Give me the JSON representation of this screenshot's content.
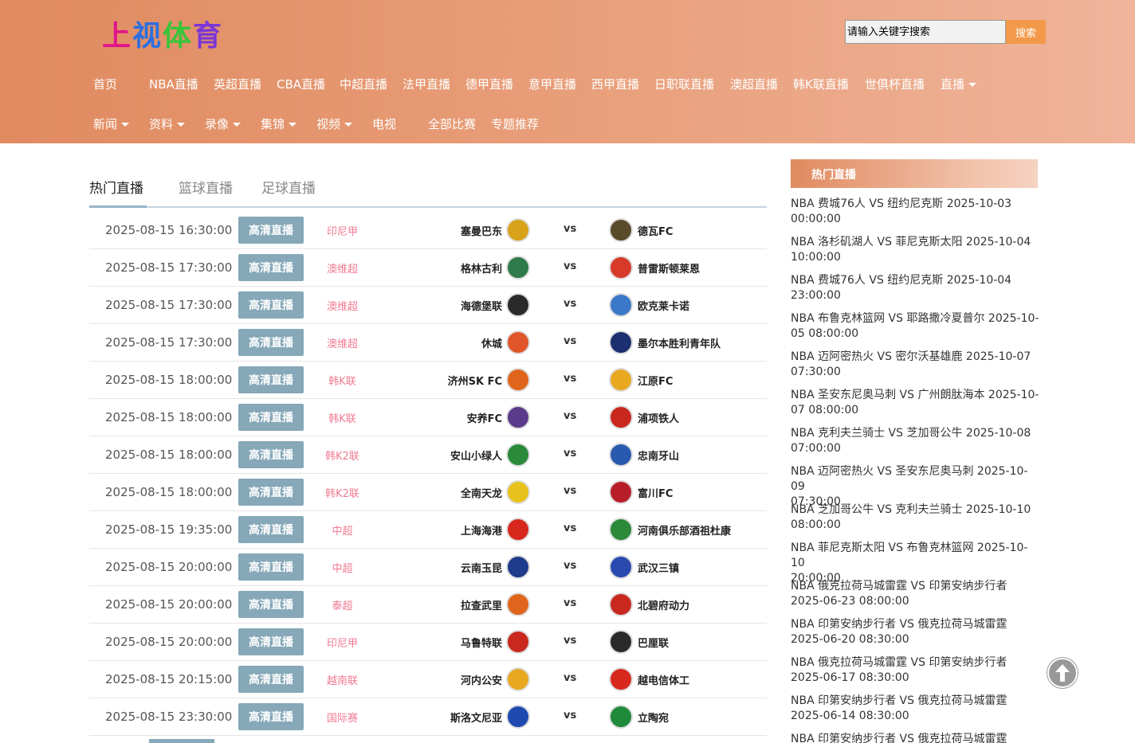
{
  "header": {
    "logo_chars": [
      "上",
      "视",
      "体",
      "育"
    ],
    "search_placeholder": "请输入关键字搜索",
    "search_button": "搜索"
  },
  "nav_primary": [
    {
      "label": "首页",
      "dropdown": false
    },
    {
      "label": "NBA直播",
      "dropdown": false
    },
    {
      "label": "英超直播",
      "dropdown": false
    },
    {
      "label": "CBA直播",
      "dropdown": false
    },
    {
      "label": "中超直播",
      "dropdown": false
    },
    {
      "label": "法甲直播",
      "dropdown": false
    },
    {
      "label": "德甲直播",
      "dropdown": false
    },
    {
      "label": "意甲直播",
      "dropdown": false
    },
    {
      "label": "西甲直播",
      "dropdown": false
    },
    {
      "label": "日职联直播",
      "dropdown": false
    },
    {
      "label": "澳超直播",
      "dropdown": false
    },
    {
      "label": "韩K联直播",
      "dropdown": false
    },
    {
      "label": "世俱杯直播",
      "dropdown": false
    },
    {
      "label": "直播",
      "dropdown": true
    }
  ],
  "nav_secondary": [
    {
      "label": "新闻",
      "dropdown": true
    },
    {
      "label": "资料",
      "dropdown": true
    },
    {
      "label": "录像",
      "dropdown": true
    },
    {
      "label": "集锦",
      "dropdown": true
    },
    {
      "label": "视频",
      "dropdown": true
    },
    {
      "label": "电视",
      "dropdown": false
    },
    {
      "label": "全部比赛",
      "dropdown": false
    },
    {
      "label": "专题推荐",
      "dropdown": false
    }
  ],
  "tabs": [
    {
      "label": "热门直播",
      "active": true
    },
    {
      "label": "篮球直播",
      "active": false
    },
    {
      "label": "足球直播",
      "active": false
    }
  ],
  "live_label": "高清直播",
  "vs_label": "vs",
  "matches": [
    {
      "time": "2025-08-15 16:30:00",
      "league": "印尼甲",
      "home": "塞曼巴东",
      "away": "德瓦FC",
      "home_color": "#d9a21b",
      "away_color": "#5a4a2c"
    },
    {
      "time": "2025-08-15 17:30:00",
      "league": "澳维超",
      "home": "格林古利",
      "away": "普雷斯顿莱恩",
      "home_color": "#2f7a4a",
      "away_color": "#d83a2a"
    },
    {
      "time": "2025-08-15 17:30:00",
      "league": "澳维超",
      "home": "海德堡联",
      "away": "欧克莱卡诺",
      "home_color": "#2a2a2a",
      "away_color": "#3a78c8"
    },
    {
      "time": "2025-08-15 17:30:00",
      "league": "澳维超",
      "home": "休城",
      "away": "墨尔本胜利青年队",
      "home_color": "#e0552a",
      "away_color": "#1c2f6e"
    },
    {
      "time": "2025-08-15 18:00:00",
      "league": "韩K联",
      "home": "济州SK FC",
      "away": "江原FC",
      "home_color": "#e0651c",
      "away_color": "#e8a820"
    },
    {
      "time": "2025-08-15 18:00:00",
      "league": "韩K联",
      "home": "安养FC",
      "away": "浦项铁人",
      "home_color": "#5a3a8a",
      "away_color": "#c8281e"
    },
    {
      "time": "2025-08-15 18:00:00",
      "league": "韩K2联",
      "home": "安山小绿人",
      "away": "忠南牙山",
      "home_color": "#2a8a3a",
      "away_color": "#2a5ab0"
    },
    {
      "time": "2025-08-15 18:00:00",
      "league": "韩K2联",
      "home": "全南天龙",
      "away": "富川FC",
      "home_color": "#e8c21c",
      "away_color": "#b81e2a"
    },
    {
      "time": "2025-08-15 19:35:00",
      "league": "中超",
      "home": "上海海港",
      "away": "河南俱乐部酒祖杜康",
      "home_color": "#d8281e",
      "away_color": "#2a8a3a"
    },
    {
      "time": "2025-08-15 20:00:00",
      "league": "中超",
      "home": "云南玉昆",
      "away": "武汉三镇",
      "home_color": "#1e3a8a",
      "away_color": "#2a4ab0"
    },
    {
      "time": "2025-08-15 20:00:00",
      "league": "泰超",
      "home": "拉查武里",
      "away": "北碧府动力",
      "home_color": "#e0651c",
      "away_color": "#c8281e"
    },
    {
      "time": "2025-08-15 20:00:00",
      "league": "印尼甲",
      "home": "马鲁特联",
      "away": "巴厘联",
      "home_color": "#c8281e",
      "away_color": "#2a2a2a"
    },
    {
      "time": "2025-08-15 20:15:00",
      "league": "越南联",
      "home": "河内公安",
      "away": "越电信体工",
      "home_color": "#e8a820",
      "away_color": "#d8281e"
    },
    {
      "time": "2025-08-15 23:30:00",
      "league": "国际赛",
      "home": "斯洛文尼亚",
      "away": "立陶宛",
      "home_color": "#1e4ab0",
      "away_color": "#1e8a3a"
    }
  ],
  "sidebar": {
    "title": "热门直播",
    "items": [
      {
        "line1": "NBA 费城76人 VS 纽约尼克斯 2025-10-03",
        "line2": "00:00:00"
      },
      {
        "line1": "NBA 洛杉矶湖人 VS 菲尼克斯太阳 2025-10-04",
        "line2": "10:00:00"
      },
      {
        "line1": "NBA 费城76人 VS 纽约尼克斯 2025-10-04",
        "line2": "23:00:00"
      },
      {
        "line1": "NBA 布鲁克林篮网 VS 耶路撒冷夏普尔 2025-10-",
        "line2": "05 08:00:00"
      },
      {
        "line1": "NBA 迈阿密热火 VS 密尔沃基雄鹿 2025-10-07",
        "line2": "07:30:00"
      },
      {
        "line1": "NBA 圣安东尼奥马刺 VS 广州朗肽海本 2025-10-",
        "line2": "07 08:00:00"
      },
      {
        "line1": "NBA 克利夫兰骑士 VS 芝加哥公牛 2025-10-08",
        "line2": "07:00:00"
      },
      {
        "line1": "NBA 迈阿密热火 VS 圣安东尼奥马刺 2025-10-09",
        "line2": "07:30:00"
      },
      {
        "line1": "NBA 芝加哥公牛 VS 克利夫兰骑士 2025-10-10",
        "line2": "08:00:00"
      },
      {
        "line1": "NBA 菲尼克斯太阳 VS 布鲁克林篮网 2025-10-10",
        "line2": "20:00:00"
      },
      {
        "line1": "NBA 俄克拉荷马城雷霆 VS 印第安纳步行者",
        "line2": "2025-06-23 08:00:00"
      },
      {
        "line1": "NBA 印第安纳步行者 VS 俄克拉荷马城雷霆",
        "line2": "2025-06-20 08:30:00"
      },
      {
        "line1": "NBA 俄克拉荷马城雷霆 VS 印第安纳步行者",
        "line2": "2025-06-17 08:30:00"
      },
      {
        "line1": "NBA 印第安纳步行者 VS 俄克拉荷马城雷霆",
        "line2": "2025-06-14 08:30:00"
      },
      {
        "line1": "NBA 印第安纳步行者 VS 俄克拉荷马城雷霆",
        "line2": ""
      }
    ]
  }
}
